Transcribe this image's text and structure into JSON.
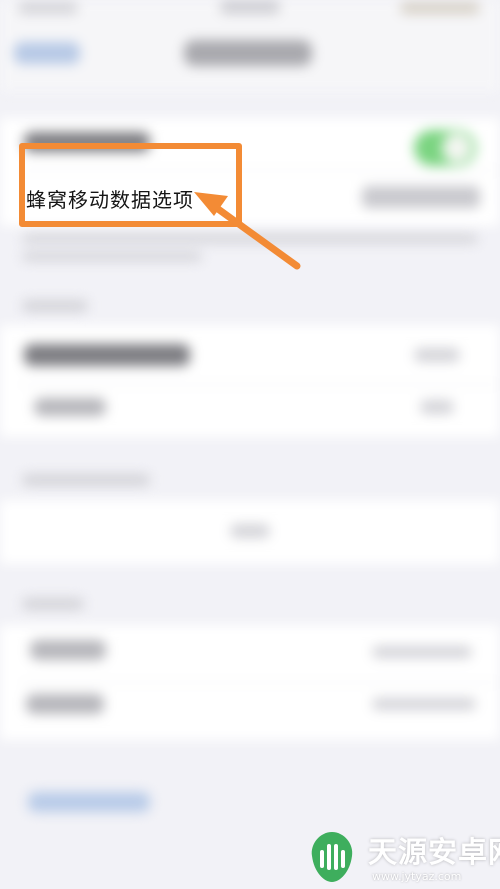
{
  "cellular_row": {
    "label": "蜂窝移动数据选项"
  },
  "watermark": {
    "title": "天源安卓网",
    "url": "www.jytyaz.com"
  },
  "colors": {
    "highlight": "#f38b35",
    "toggle_on": "#7ad480",
    "background": "#f2f2f7"
  },
  "icons": {
    "toggle": "toggle-switch-icon",
    "chevron": "chevron-right-icon",
    "arrow": "arrow-pointer-icon",
    "watermark_logo": "android-logo-icon"
  }
}
